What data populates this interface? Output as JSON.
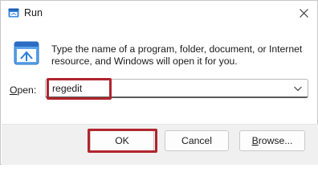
{
  "window": {
    "title": "Run",
    "icon": "run-app-icon",
    "close_icon": "close-icon"
  },
  "dialog": {
    "description": "Type the name of a program, folder, document, or Internet resource, and Windows will open it for you.",
    "open_label_first": "O",
    "open_label_rest": "pen:",
    "input_value": "regedit"
  },
  "buttons": {
    "ok": "OK",
    "cancel": "Cancel",
    "browse_first": "B",
    "browse_rest": "rowse..."
  },
  "colors": {
    "highlight": "#b0252d",
    "footer_bg": "#f0f0f0"
  }
}
